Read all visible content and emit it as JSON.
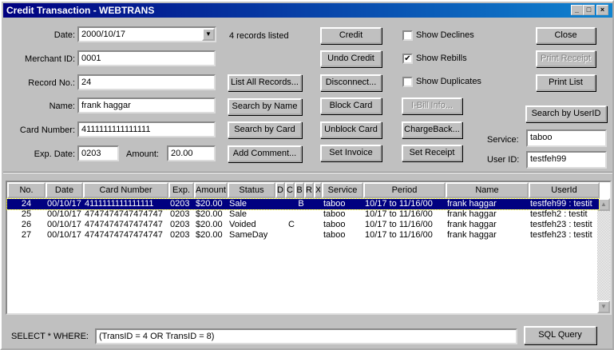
{
  "window": {
    "title": "Credit Transaction - WEBTRANS",
    "min": "_",
    "max": "□",
    "close": "×"
  },
  "form": {
    "date_label": "Date:",
    "date": "2000/10/17",
    "merchant_label": "Merchant ID:",
    "merchant": "0001",
    "record_label": "Record No.:",
    "record": "24",
    "name_label": "Name:",
    "name": "frank haggar",
    "card_label": "Card Number:",
    "card": "4111111111111111",
    "exp_label": "Exp. Date:",
    "exp": "0203",
    "amount_label": "Amount:",
    "amount": "20.00",
    "records_listed": "4 records listed",
    "service_label": "Service:",
    "service": "taboo",
    "userid_label": "User ID:",
    "userid": "testfeh99"
  },
  "buttons": {
    "list_all": "List All Records...",
    "search_name": "Search by Name",
    "search_card": "Search by Card",
    "add_comment": "Add Comment...",
    "credit": "Credit",
    "undo_credit": "Undo Credit",
    "disconnect": "Disconnect...",
    "block_card": "Block Card",
    "unblock_card": "Unblock Card",
    "set_invoice": "Set Invoice",
    "ibill": "I-Bill Info...",
    "chargeback": "ChargeBack...",
    "set_receipt": "Set Receipt",
    "close": "Close",
    "print_receipt": "Print Receipt",
    "print_list": "Print List",
    "search_userid": "Search by UserID",
    "sql_query": "SQL Query"
  },
  "checks": [
    {
      "label": "Show Declines",
      "checked": false
    },
    {
      "label": "Show Rebills",
      "checked": true
    },
    {
      "label": "Show Duplicates",
      "checked": false
    }
  ],
  "table": {
    "columns": [
      "No.",
      "Date",
      "Card Number",
      "Exp.",
      "Amount",
      "Status",
      "D",
      "C",
      "B",
      "R",
      "X",
      "Service",
      "Period",
      "Name",
      "UserId"
    ],
    "rows": [
      [
        "24",
        "00/10/17",
        "4111111111111111",
        "0203",
        "$20.00",
        "Sale",
        "",
        "",
        "B",
        "",
        "",
        "taboo",
        "10/17 to 11/16/00",
        "frank haggar",
        "testfeh99 : testit"
      ],
      [
        "25",
        "00/10/17",
        "4747474747474747",
        "0203",
        "$20.00",
        "Sale",
        "",
        "",
        "",
        "",
        "",
        "taboo",
        "10/17 to 11/16/00",
        "frank haggar",
        "testfeh2 : testit"
      ],
      [
        "26",
        "00/10/17",
        "4747474747474747",
        "0203",
        "$20.00",
        "Voided",
        "",
        "C",
        "",
        "",
        "",
        "taboo",
        "10/17 to 11/16/00",
        "frank haggar",
        "testfeh23 : testit"
      ],
      [
        "27",
        "00/10/17",
        "4747474747474747",
        "0203",
        "$20.00",
        "SameDay",
        "",
        "",
        "",
        "",
        "",
        "taboo",
        "10/17 to 11/16/00",
        "frank haggar",
        "testfeh23 : testit"
      ]
    ]
  },
  "query": {
    "label": "SELECT * WHERE:",
    "value": "(TransID = 4 OR TransID = 8)"
  }
}
